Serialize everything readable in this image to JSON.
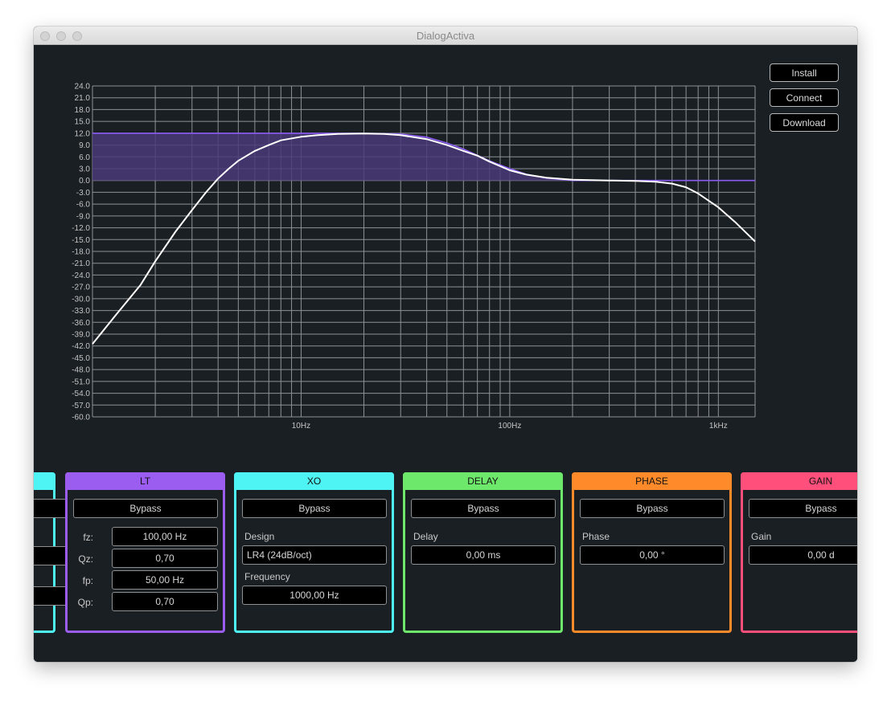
{
  "window": {
    "title": "DialogActiva"
  },
  "side_buttons": {
    "install": "Install",
    "connect": "Connect",
    "download": "Download"
  },
  "chart_data": {
    "type": "line",
    "x_scale": "log",
    "xlim": [
      1,
      1500
    ],
    "ylim": [
      -60,
      24
    ],
    "y_ticks": [
      "24.0",
      "21.0",
      "18.0",
      "15.0",
      "12.0",
      "9.0",
      "6.0",
      "3.0",
      "0.0",
      "-3.0",
      "-6.0",
      "-9.0",
      "-12.0",
      "-15.0",
      "-18.0",
      "-21.0",
      "-24.0",
      "-27.0",
      "-30.0",
      "-33.0",
      "-36.0",
      "-39.0",
      "-42.0",
      "-45.0",
      "-48.0",
      "-51.0",
      "-54.0",
      "-57.0",
      "-60.0"
    ],
    "x_tick_labels": [
      {
        "value": 10,
        "label": "10Hz"
      },
      {
        "value": 100,
        "label": "100Hz"
      },
      {
        "value": 1000,
        "label": "1kHz"
      }
    ],
    "grid": true,
    "colors": {
      "response": "#ffffff",
      "shelf_line": "#8a5cf0",
      "shelf_fill": "#4a3a78",
      "grid": "#8d9295",
      "background": "#1a1f24"
    },
    "series": [
      {
        "x": [
          1,
          1.3,
          1.7,
          2,
          2.5,
          3,
          3.5,
          4,
          4.5,
          5,
          6,
          7,
          8,
          10,
          12,
          15,
          20,
          25,
          30,
          40,
          50,
          60,
          70,
          80,
          100,
          120,
          150,
          200,
          300,
          400,
          500,
          600,
          700,
          800,
          1000,
          1200,
          1500
        ],
        "y": [
          -41.5,
          -34,
          -26.5,
          -20.5,
          -13,
          -7.5,
          -3,
          0.5,
          3,
          5,
          7.5,
          9,
          10.2,
          11.1,
          11.5,
          11.8,
          11.9,
          11.8,
          11.5,
          10.5,
          9,
          7.5,
          6.3,
          4.8,
          2.6,
          1.5,
          0.7,
          0.2,
          0.0,
          -0.1,
          -0.3,
          -0.8,
          -1.7,
          -3.3,
          -6.8,
          -10.5,
          -15.5
        ]
      },
      {
        "x": [
          1,
          2,
          5,
          10,
          20,
          30,
          40,
          50,
          60,
          80,
          100,
          120,
          150,
          200,
          1500
        ],
        "y": [
          12,
          12,
          12,
          12,
          12,
          11.8,
          11,
          9.5,
          8,
          5,
          3,
          1.6,
          0.6,
          0.0,
          0.0
        ]
      }
    ]
  },
  "modules": {
    "lt": {
      "title": "LT",
      "bypass": "Bypass",
      "fz_label": "fz:",
      "fz": "100,00 Hz",
      "qz_label": "Qz:",
      "qz": "0,70",
      "fp_label": "fp:",
      "fp": "50,00 Hz",
      "qp_label": "Qp:",
      "qp": "0,70",
      "color": "#9b5df0"
    },
    "xo": {
      "title": "XO",
      "bypass": "Bypass",
      "design_label": "Design",
      "design": "LR4 (24dB/oct)",
      "frequency_label": "Frequency",
      "frequency": "1000,00 Hz",
      "color": "#4ef3f3"
    },
    "delay": {
      "title": "DELAY",
      "bypass": "Bypass",
      "delay_label": "Delay",
      "delay": "0,00 ms",
      "color": "#6ee86a"
    },
    "phase": {
      "title": "PHASE",
      "bypass": "Bypass",
      "phase_label": "Phase",
      "phase": "0,00 °",
      "color": "#ff8a2a"
    },
    "gain": {
      "title": "GAIN",
      "bypass": "Bypass",
      "gain_label": "Gain",
      "gain": "0,00 d",
      "color": "#ff4f7a"
    }
  }
}
